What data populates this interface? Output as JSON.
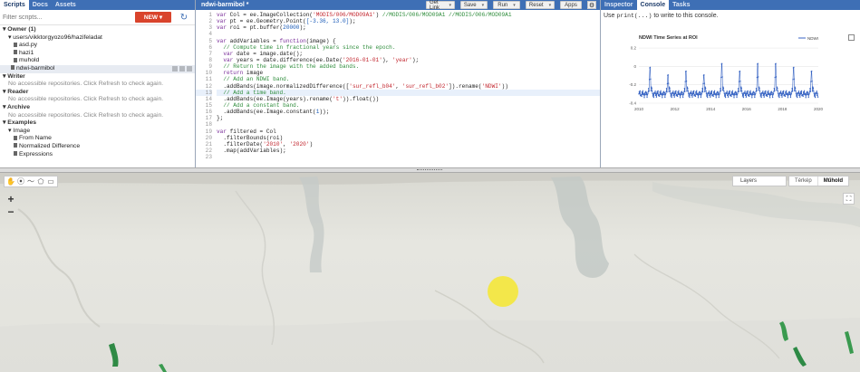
{
  "left_panel": {
    "tabs": [
      "Scripts",
      "Docs",
      "Assets"
    ],
    "filter_placeholder": "Filter scripts...",
    "new_button": "NEW",
    "tree": [
      {
        "text": "▾ Owner (1)",
        "kind": "section",
        "indent": 1
      },
      {
        "text": "▾ users/vikktorgyozo96/hazifeladat",
        "kind": "folder",
        "indent": 2
      },
      {
        "text": "asd.py",
        "kind": "file",
        "indent": 3
      },
      {
        "text": "hazi1",
        "kind": "file",
        "indent": 3
      },
      {
        "text": "muhold",
        "kind": "file",
        "indent": 3
      },
      {
        "text": "ndwi-barmibol",
        "kind": "file",
        "indent": 3,
        "selected": true
      },
      {
        "text": "▾ Writer",
        "kind": "section",
        "indent": 1
      },
      {
        "text": "No accessible repositories. Click Refresh to check again.",
        "kind": "muted",
        "indent": 2
      },
      {
        "text": "▾ Reader",
        "kind": "section",
        "indent": 1
      },
      {
        "text": "No accessible repositories. Click Refresh to check again.",
        "kind": "muted",
        "indent": 2
      },
      {
        "text": "▾ Archive",
        "kind": "section",
        "indent": 1
      },
      {
        "text": "No accessible repositories. Click Refresh to check again.",
        "kind": "muted",
        "indent": 2
      },
      {
        "text": "▾ Examples",
        "kind": "section",
        "indent": 1
      },
      {
        "text": "▾ Image",
        "kind": "folder",
        "indent": 2
      },
      {
        "text": "From Name",
        "kind": "file",
        "indent": 3
      },
      {
        "text": "Normalized Difference",
        "kind": "file",
        "indent": 3
      },
      {
        "text": "Expressions",
        "kind": "file",
        "indent": 3
      }
    ]
  },
  "editor": {
    "file_tab": "ndwi-barmibol *",
    "buttons": [
      "Get Link",
      "Save",
      "Run",
      "Reset",
      "Apps"
    ],
    "highlight_line": 13,
    "lines": [
      [
        [
          "k",
          "var "
        ],
        [
          "",
          "Col = ee.ImageCollection("
        ],
        [
          "s",
          "'MODIS/006/MOD09A1'"
        ],
        [
          "",
          ") "
        ],
        [
          "c",
          "//MODIS/006/MOD09A1 //MODIS/006/MOD09A1"
        ]
      ],
      [
        [
          "k",
          "var "
        ],
        [
          "",
          "pt = ee.Geometry.Point("
        ],
        [
          "n",
          "[-3.36, 13.0]"
        ],
        [
          "",
          ");"
        ]
      ],
      [
        [
          "k",
          "var "
        ],
        [
          "",
          "roi = pt.buffer("
        ],
        [
          "n",
          "20000"
        ],
        [
          "",
          ");"
        ]
      ],
      [
        [
          "",
          ""
        ]
      ],
      [
        [
          "k",
          "var "
        ],
        [
          "",
          "addVariables = "
        ],
        [
          "k",
          "function"
        ],
        [
          "",
          "(image) {"
        ]
      ],
      [
        [
          "c",
          "  // Compute time in fractional years since the epoch."
        ]
      ],
      [
        [
          "k",
          "  var "
        ],
        [
          "",
          "date = image.date();"
        ]
      ],
      [
        [
          "k",
          "  var "
        ],
        [
          "",
          "years = date.difference(ee.Date("
        ],
        [
          "s",
          "'2016-01-01'"
        ],
        [
          "",
          "), "
        ],
        [
          "s",
          "'year'"
        ],
        [
          "",
          ");"
        ]
      ],
      [
        [
          "c",
          "  // Return the image with the added bands."
        ]
      ],
      [
        [
          "k",
          "  return "
        ],
        [
          "",
          "image"
        ]
      ],
      [
        [
          "c",
          "  // Add an NDWI band."
        ]
      ],
      [
        [
          "",
          "  .addBands(image.normalizedDifference(["
        ],
        [
          "s",
          "'sur_refl_b04'"
        ],
        [
          "",
          ", "
        ],
        [
          "s",
          "'sur_refl_b02'"
        ],
        [
          "",
          "]).rename("
        ],
        [
          "s",
          "'NDWI'"
        ],
        [
          "",
          "))"
        ]
      ],
      [
        [
          "c",
          "  // Add a time band."
        ]
      ],
      [
        [
          "",
          "  .addBands(ee.Image(years).rename("
        ],
        [
          "s",
          "'t'"
        ],
        [
          "",
          ")).float())"
        ]
      ],
      [
        [
          "c",
          "  // Add a constant band."
        ]
      ],
      [
        [
          "",
          "  .addBands(ee.Image.constant("
        ],
        [
          "n",
          "1"
        ],
        [
          "",
          "));"
        ]
      ],
      [
        [
          "",
          "};"
        ]
      ],
      [
        [
          "",
          ""
        ]
      ],
      [
        [
          "k",
          "var "
        ],
        [
          "",
          "filtered = Col"
        ]
      ],
      [
        [
          "",
          "  .filterBounds(roi)"
        ]
      ],
      [
        [
          "",
          "  .filterDate("
        ],
        [
          "s",
          "'2010'"
        ],
        [
          "",
          ", "
        ],
        [
          "s",
          "'2020'"
        ],
        [
          "",
          ")"
        ]
      ],
      [
        [
          "",
          "  .map(addVariables);"
        ]
      ],
      [
        [
          "",
          ""
        ]
      ]
    ]
  },
  "right_panel": {
    "tabs": [
      "Inspector",
      "Console",
      "Tasks"
    ],
    "console_prefix": "Use ",
    "console_code": "print(...)",
    "console_suffix": " to write to this console."
  },
  "chart_data": {
    "type": "line",
    "title": "NDWI Time Series at ROI",
    "series": [
      {
        "name": "NDWI"
      }
    ],
    "xlim": [
      2010,
      2020
    ],
    "ylim": [
      -0.4,
      0.25
    ],
    "xticks": [
      2010,
      2012,
      2014,
      2016,
      2018,
      2020
    ],
    "yticks": [
      -0.4,
      -0.2,
      0.0,
      0.2
    ],
    "seasonal_pattern": {
      "baseline": -0.3,
      "annual_peak": [
        0.05,
        -0.05,
        0.0,
        -0.05,
        0.1,
        0.0,
        0.1,
        0.1,
        0.05,
        0.0
      ]
    },
    "line_color": "#3a66c4"
  },
  "map": {
    "layers_label": "Layers",
    "map_types": [
      "Térkép",
      "Műhold"
    ],
    "active_map_type": "Műhold",
    "zoom_in": "+",
    "zoom_out": "−",
    "marker_color": "#f3e74a"
  }
}
